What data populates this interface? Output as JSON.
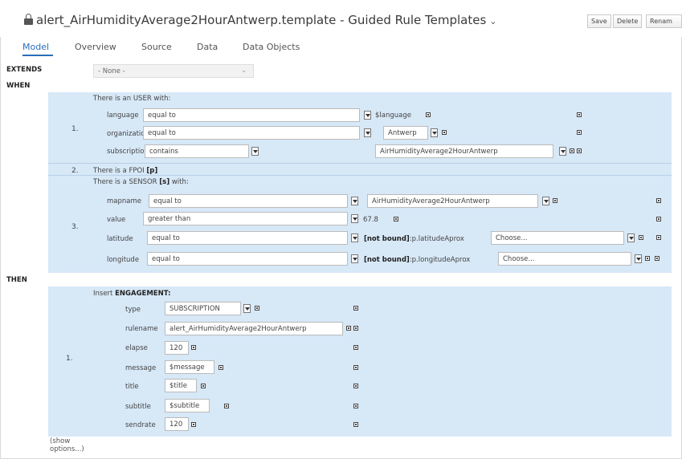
{
  "window": {
    "title": "alert_AirHumidityAverage2HourAntwerp.template - Guided Rule Templates",
    "buttons": {
      "save": "Save",
      "delete": "Delete",
      "rename": "Renam"
    }
  },
  "tabs": [
    "Model",
    "Overview",
    "Source",
    "Data",
    "Data Objects"
  ],
  "extends": {
    "label": "EXTENDS",
    "value": "- None -"
  },
  "when": {
    "label": "WHEN",
    "patterns": [
      {
        "number": "1.",
        "header": "There is an USER with:",
        "rows": [
          {
            "field": "language",
            "operator": "equal to",
            "value": "$language"
          },
          {
            "field": "organization",
            "operator": "equal to",
            "value": "Antwerp"
          },
          {
            "field": "subscriptions",
            "operator": "contains",
            "value": "AirHumidityAverage2HourAntwerp"
          }
        ]
      },
      {
        "number": "2.",
        "header_prefix": "There is a FPOI",
        "header_bold": "[p]"
      },
      {
        "number": "3.",
        "header_prefix": "There is a SENSOR",
        "header_bold": "[s]",
        "header_suffix": "with:",
        "rows": [
          {
            "field": "mapname",
            "operator": "equal to",
            "value": "AirHumidityAverage2HourAntwerp"
          },
          {
            "field": "value",
            "operator": "greater than",
            "value": "67.8"
          },
          {
            "field": "latitude",
            "operator": "equal to",
            "bound_bold": "[not bound]",
            "bound_text": ":p.latitudeAprox",
            "choose": "Choose..."
          },
          {
            "field": "longitude",
            "operator": "equal to",
            "bound_bold": "[not bound]",
            "bound_text": ":p.longitudeAprox",
            "choose": "Choose..."
          }
        ]
      }
    ]
  },
  "then": {
    "label": "THEN",
    "action": {
      "number": "1.",
      "header_prefix": "Insert",
      "header_bold": "ENGAGEMENT:",
      "fields": [
        {
          "name": "type",
          "value": "SUBSCRIPTION"
        },
        {
          "name": "rulename",
          "value": "alert_AirHumidityAverage2HourAntwerp"
        },
        {
          "name": "elapse",
          "value": "120"
        },
        {
          "name": "message",
          "value": "$message"
        },
        {
          "name": "title",
          "value": "$title"
        },
        {
          "name": "subtitle",
          "value": "$subtitle"
        },
        {
          "name": "sendrate",
          "value": "120"
        }
      ]
    }
  },
  "show_options": [
    "(show",
    "options...)"
  ]
}
